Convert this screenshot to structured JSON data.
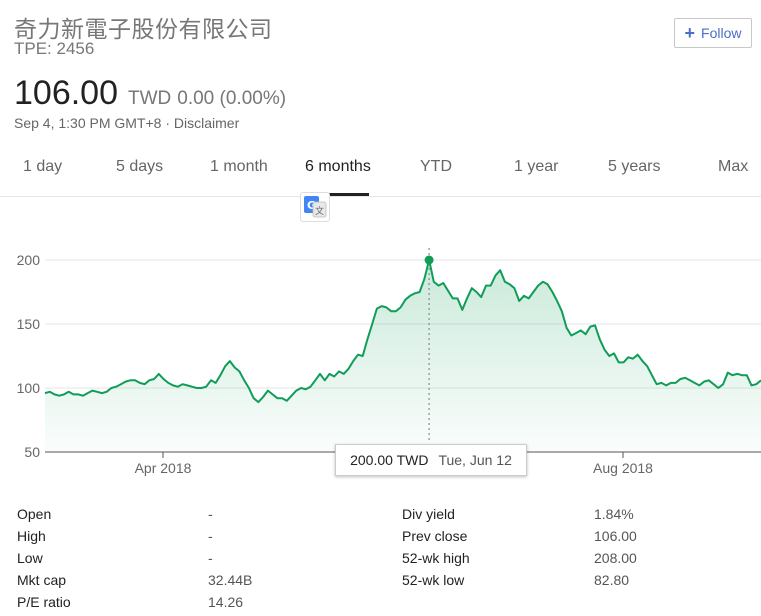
{
  "header": {
    "title": "奇力新電子股份有限公司",
    "ticker": "TPE: 2456",
    "follow_label": "Follow",
    "price": "106.00",
    "currency": "TWD",
    "change": "0.00 (0.00%)",
    "timestamp": "Sep 4, 1:30 PM GMT+8 · Disclaimer"
  },
  "tabs": [
    {
      "label": "1 day"
    },
    {
      "label": "5 days"
    },
    {
      "label": "1 month"
    },
    {
      "label": "6 months",
      "active": true
    },
    {
      "label": "YTD"
    },
    {
      "label": "1 year"
    },
    {
      "label": "5 years"
    },
    {
      "label": "Max"
    }
  ],
  "tooltip": {
    "value": "200.00 TWD",
    "date": "Tue, Jun 12"
  },
  "chart_data": {
    "type": "area",
    "y_ticks": [
      200,
      150,
      100,
      50
    ],
    "ylim": [
      50,
      200
    ],
    "x_ticks": [
      "Apr 2018",
      "Aug 2018"
    ],
    "line_color": "#0f9d58",
    "grid": true,
    "values": [
      96,
      97,
      95,
      94,
      95,
      97,
      95,
      95,
      94,
      96,
      98,
      97,
      96,
      97,
      100,
      101,
      103,
      105,
      106,
      106,
      104,
      103,
      106,
      107,
      111,
      107,
      104,
      102,
      101,
      103,
      102,
      101,
      100,
      100,
      101,
      106,
      104,
      110,
      117,
      121,
      116,
      113,
      106,
      100,
      92,
      89,
      93,
      98,
      95,
      92,
      92,
      90,
      94,
      98,
      100,
      99,
      101,
      106,
      111,
      106,
      111,
      109,
      113,
      111,
      115,
      121,
      126,
      125,
      138,
      150,
      162,
      164,
      163,
      160,
      160,
      163,
      169,
      172,
      174,
      175,
      185,
      200,
      183,
      180,
      182,
      176,
      170,
      170,
      161,
      170,
      178,
      175,
      171,
      180,
      180,
      188,
      192,
      183,
      181,
      178,
      168,
      172,
      170,
      175,
      180,
      183,
      181,
      175,
      168,
      160,
      147,
      141,
      143,
      145,
      142,
      148,
      149,
      138,
      130,
      125,
      127,
      120,
      120,
      124,
      123,
      126,
      121,
      117,
      110,
      103,
      104,
      102,
      104,
      104,
      107,
      108,
      106,
      104,
      102,
      105,
      106,
      103,
      100,
      103,
      112,
      110,
      111,
      110,
      110,
      102,
      103,
      106
    ],
    "highlight": {
      "index": 81,
      "value": 200
    }
  },
  "stats": {
    "left": [
      {
        "label": "Open",
        "value": "-"
      },
      {
        "label": "High",
        "value": "-"
      },
      {
        "label": "Low",
        "value": "-"
      },
      {
        "label": "Mkt cap",
        "value": "32.44B"
      },
      {
        "label": "P/E ratio",
        "value": "14.26"
      }
    ],
    "right": [
      {
        "label": "Div yield",
        "value": "1.84%"
      },
      {
        "label": "Prev close",
        "value": "106.00"
      },
      {
        "label": "52-wk high",
        "value": "208.00"
      },
      {
        "label": "52-wk low",
        "value": "82.80"
      }
    ]
  }
}
